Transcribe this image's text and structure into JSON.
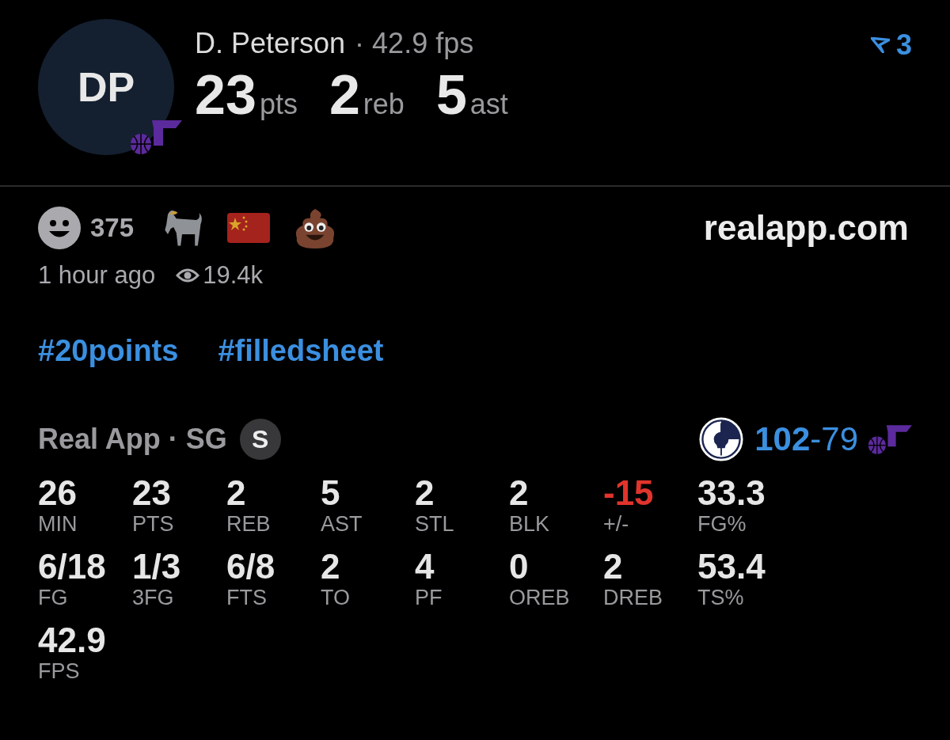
{
  "player": {
    "initials": "DP",
    "name": "D. Peterson",
    "fps": "· 42.9 fps",
    "stats": [
      {
        "value": "23",
        "unit": "pts"
      },
      {
        "value": "2",
        "unit": "reb"
      },
      {
        "value": "5",
        "unit": "ast"
      }
    ],
    "badge_count": "3"
  },
  "reactions": {
    "count": "375",
    "site": "realapp.com"
  },
  "meta": {
    "time": "1 hour ago",
    "views": "19.4k"
  },
  "hashtags": [
    "#20points",
    "#filledsheet"
  ],
  "game": {
    "team_line": "Real App · SG",
    "position_badge": "S",
    "home_score": "102",
    "separator": "-",
    "away_score": "79"
  },
  "box_score": [
    [
      {
        "value": "26",
        "label": "MIN",
        "color": "#e6e6e6"
      },
      {
        "value": "23",
        "label": "PTS",
        "color": "#e6e6e6"
      },
      {
        "value": "2",
        "label": "REB",
        "color": "#e6e6e6"
      },
      {
        "value": "5",
        "label": "AST",
        "color": "#e6e6e6"
      },
      {
        "value": "2",
        "label": "STL",
        "color": "#e6e6e6"
      },
      {
        "value": "2",
        "label": "BLK",
        "color": "#e6e6e6"
      },
      {
        "value": "-15",
        "label": "+/-",
        "color": "#e0342c"
      },
      {
        "value": "33.3",
        "label": "FG%",
        "color": "#e6e6e6"
      }
    ],
    [
      {
        "value": "6/18",
        "label": "FG",
        "color": "#e6e6e6"
      },
      {
        "value": "1/3",
        "label": "3FG",
        "color": "#e6e6e6"
      },
      {
        "value": "6/8",
        "label": "FTS",
        "color": "#e6e6e6"
      },
      {
        "value": "2",
        "label": "TO",
        "color": "#e6e6e6"
      },
      {
        "value": "4",
        "label": "PF",
        "color": "#e6e6e6"
      },
      {
        "value": "0",
        "label": "OREB",
        "color": "#e6e6e6"
      },
      {
        "value": "2",
        "label": "DREB",
        "color": "#e6e6e6"
      },
      {
        "value": "53.4",
        "label": "TS%",
        "color": "#e6e6e6"
      }
    ],
    [
      {
        "value": "42.9",
        "label": "FPS",
        "color": "#e6e6e6"
      }
    ]
  ]
}
